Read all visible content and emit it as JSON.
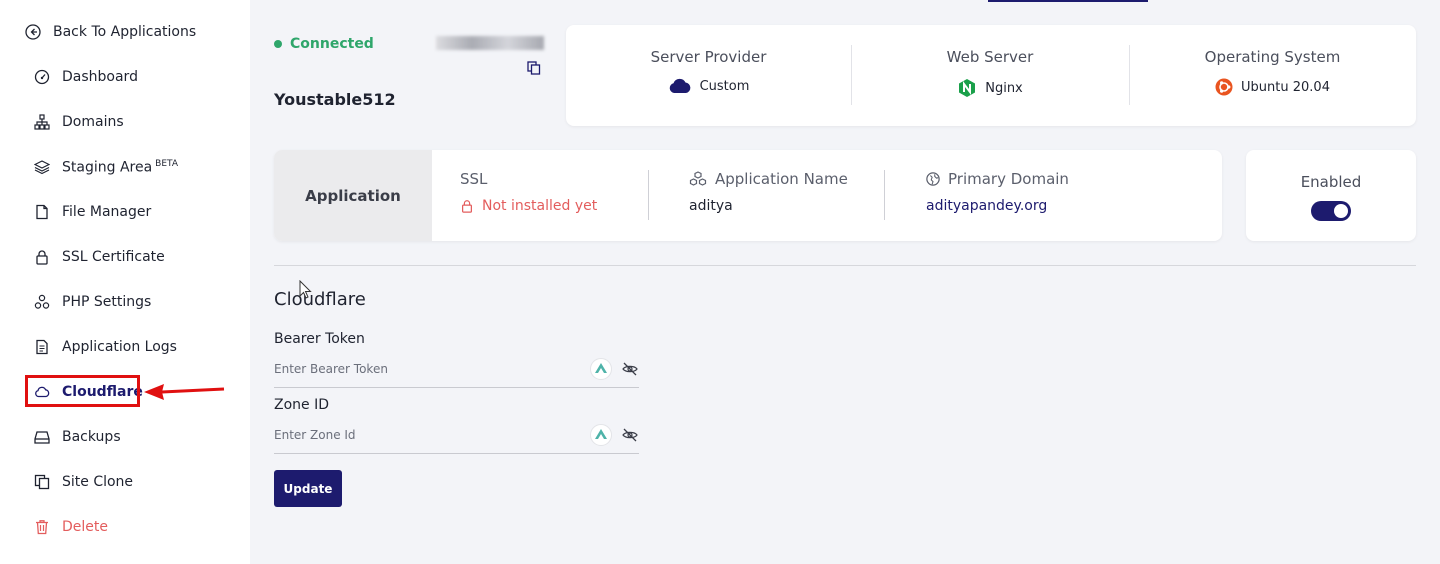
{
  "sidebar": {
    "back": "Back To Applications",
    "items": [
      {
        "label": "Dashboard"
      },
      {
        "label": "Domains"
      },
      {
        "label": "Staging Area",
        "badge": "BETA"
      },
      {
        "label": "File Manager"
      },
      {
        "label": "SSL Certificate"
      },
      {
        "label": "PHP Settings"
      },
      {
        "label": "Application Logs"
      },
      {
        "label": "Cloudflare",
        "active": true
      },
      {
        "label": "Backups"
      },
      {
        "label": "Site Clone"
      },
      {
        "label": "Delete"
      }
    ]
  },
  "header": {
    "status": "Connected",
    "app_name": "Youstable512"
  },
  "server": {
    "provider_label": "Server Provider",
    "provider_value": "Custom",
    "web_label": "Web Server",
    "web_value": "Nginx",
    "os_label": "Operating System",
    "os_value": "Ubuntu 20.04"
  },
  "application": {
    "tab": "Application",
    "ssl_label": "SSL",
    "ssl_value": "Not installed yet",
    "name_label": "Application Name",
    "name_value": "aditya",
    "domain_label": "Primary Domain",
    "domain_value": "adityapandey.org"
  },
  "status_card": {
    "label": "Enabled",
    "enabled": true
  },
  "cloudflare": {
    "title": "Cloudflare",
    "token_label": "Bearer Token",
    "token_placeholder": "Enter Bearer Token",
    "zone_label": "Zone ID",
    "zone_placeholder": "Enter Zone Id",
    "update": "Update"
  },
  "colors": {
    "accent": "#1d1b6e",
    "connected": "#2fa66b",
    "danger": "#e35d5d",
    "annotation": "#e01010"
  }
}
